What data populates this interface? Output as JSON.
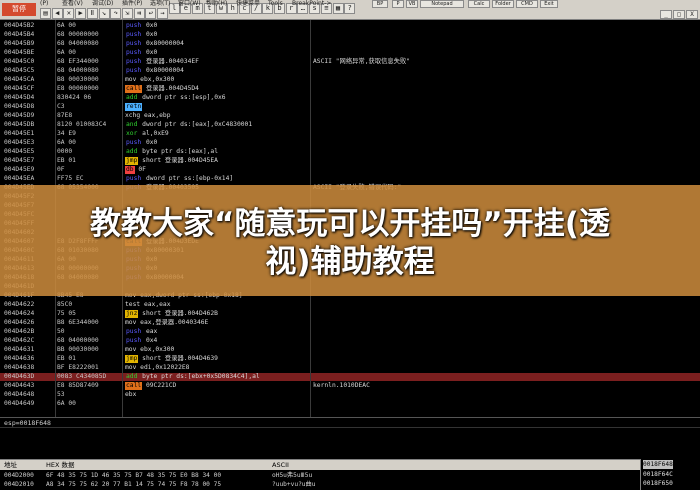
{
  "toolbar": {
    "status": "暂停",
    "icons": [
      "folder-open-icon",
      "rewind-icon",
      "close-icon",
      "play-icon",
      "pause-icon",
      "step-into-icon",
      "step-over-icon",
      "trace-into-icon",
      "trace-over-icon",
      "execute-till-return-icon",
      "goto-icon",
      "letter-l-icon",
      "letter-e-icon",
      "letter-m-icon",
      "letter-t-icon",
      "letter-w-icon",
      "letter-h-icon",
      "letter-c-icon",
      "slash-icon",
      "letter-k-icon",
      "letter-b-icon",
      "letter-r-icon",
      "ellipsis-icon",
      "letter-s-icon",
      "list-icon",
      "grid-icon",
      "help-icon"
    ],
    "menu_fragments": [
      "(P)",
      "查看(V)",
      "调试(D)",
      "插件(P)",
      "选项(T)",
      "窗口(W)",
      "帮助(H)",
      "快捷菜单",
      "Tools",
      "BreakPoint->"
    ],
    "tabs": [
      "BP",
      "P",
      "VB",
      "Notepad",
      "Calc",
      "Folder",
      "CMD",
      "Exit"
    ],
    "window_buttons": [
      "_",
      "□",
      "X"
    ]
  },
  "watermark": {
    "line1": "教教大家“随意玩可以开挂吗”开挂(透",
    "line2": "视)辅助教程"
  },
  "disasm_rows": [
    {
      "addr": "004D45B2",
      "hex": "6A 00",
      "asm": "push 0x0",
      "cmt": ""
    },
    {
      "addr": "004D45B4",
      "hex": "68 00000000",
      "asm": "push 0x0",
      "cmt": ""
    },
    {
      "addr": "004D45B9",
      "hex": "68 04000080",
      "asm": "push 0x80000004",
      "cmt": ""
    },
    {
      "addr": "004D45BE",
      "hex": "6A 00",
      "asm": "push 0x0",
      "cmt": ""
    },
    {
      "addr": "004D45C0",
      "hex": "68 EF344000",
      "asm": "push 登录器.004034EF",
      "cmt": "ASCII \"网络异常,获取信息失败\""
    },
    {
      "addr": "004D45C5",
      "hex": "68 04000080",
      "asm": "push 0x80000004",
      "cmt": ""
    },
    {
      "addr": "004D45CA",
      "hex": "B8 00030000",
      "asm": "mov ebx,0x300",
      "cmt": ""
    },
    {
      "addr": "004D45CF",
      "hex": "E8 00000000",
      "asm": "call 登录器.004D45D4",
      "cmt": ""
    },
    {
      "addr": "004D45D4",
      "hex": "830424 06",
      "asm": "add dword ptr ss:[esp],0x6",
      "cmt": ""
    },
    {
      "addr": "004D45D8",
      "hex": "C3",
      "asm": "retn",
      "cmt": ""
    },
    {
      "addr": "004D45D9",
      "hex": "87E8",
      "asm": "xchg eax,ebp",
      "cmt": ""
    },
    {
      "addr": "004D45DB",
      "hex": "8120 010083C4",
      "asm": "and dword ptr ds:[eax],0xC4830001",
      "cmt": ""
    },
    {
      "addr": "004D45E1",
      "hex": "34 E9",
      "asm": "xor al,0xE9",
      "cmt": ""
    },
    {
      "addr": "004D45E3",
      "hex": "6A 00",
      "asm": "push 0x0",
      "cmt": ""
    },
    {
      "addr": "004D45E5",
      "hex": "0000",
      "asm": "add byte ptr ds:[eax],al",
      "cmt": ""
    },
    {
      "addr": "004D45E7",
      "hex": "EB 01",
      "asm": "jmp short 登录器.004D45EA",
      "cmt": ""
    },
    {
      "addr": "004D45E9",
      "hex": "0F",
      "asm": "db 0F",
      "cmt": ""
    },
    {
      "addr": "004D45EA",
      "hex": "FF75 EC",
      "asm": "push dword ptr ss:[ebp-0x14]",
      "cmt": ""
    },
    {
      "addr": "004D45ED",
      "hex": "68 05354000",
      "asm": "push 登录器.00403505",
      "cmt": "ASCII \"登录失败,错误代码:\""
    },
    {
      "addr": "004D45F2",
      "hex": "",
      "asm": "",
      "cmt": ""
    },
    {
      "addr": "004D45F7",
      "hex": "",
      "asm": "",
      "cmt": ""
    },
    {
      "addr": "004D45FC",
      "hex": "",
      "asm": "[ebp",
      "cmt": ""
    },
    {
      "addr": "004D45FF",
      "hex": "",
      "asm": "",
      "cmt": ""
    },
    {
      "addr": "004D4602",
      "hex": "",
      "asm": "",
      "cmt": ""
    },
    {
      "addr": "004D4607",
      "hex": "E8 D2F8FFFF",
      "asm": "call 登录器.004D3EDE",
      "cmt": ""
    },
    {
      "addr": "004D460C",
      "hex": "68 01030080",
      "asm": "push 0x80000301",
      "cmt": ""
    },
    {
      "addr": "004D4611",
      "hex": "6A 00",
      "asm": "push 0x0",
      "cmt": ""
    },
    {
      "addr": "004D4613",
      "hex": "68 00000000",
      "asm": "push 0x0",
      "cmt": ""
    },
    {
      "addr": "004D4618",
      "hex": "68 04000080",
      "asm": "push 0x80000004",
      "cmt": ""
    },
    {
      "addr": "004D461D",
      "hex": "",
      "asm": "",
      "cmt": ""
    },
    {
      "addr": "004D461F",
      "hex": "8B45 E8",
      "asm": "mov eax,dword ptr ss:[ebp-0x18]",
      "cmt": ""
    },
    {
      "addr": "004D4622",
      "hex": "85C0",
      "asm": "test eax,eax",
      "cmt": ""
    },
    {
      "addr": "004D4624",
      "hex": "75 05",
      "asm": "jnz short 登录器.004D462B",
      "cmt": ""
    },
    {
      "addr": "004D4626",
      "hex": "B8 6E344000",
      "asm": "mov eax,登录器.0040346E",
      "cmt": ""
    },
    {
      "addr": "004D462B",
      "hex": "50",
      "asm": "push eax",
      "cmt": ""
    },
    {
      "addr": "004D462C",
      "hex": "68 04000000",
      "asm": "push 0x4",
      "cmt": ""
    },
    {
      "addr": "004D4631",
      "hex": "BB 00030000",
      "asm": "mov ebx,0x300",
      "cmt": ""
    },
    {
      "addr": "004D4636",
      "hex": "EB 01",
      "asm": "jmp short 登录器.004D4639",
      "cmt": ""
    },
    {
      "addr": "004D4638",
      "hex": "BF E8222001",
      "asm": "mov edi,0x12022E8",
      "cmt": ""
    },
    {
      "addr": "004D463D",
      "hex": "0083 C434085D",
      "asm": "add byte ptr ds:[ebx+0x5D0834C4],al",
      "cmt": ""
    },
    {
      "addr": "004D4643",
      "hex": "E8 85D87409",
      "asm": "call 09C221CD",
      "cmt": "kernln.1010DEAC"
    },
    {
      "addr": "004D4648",
      "hex": "53",
      "asm": "ebx",
      "cmt": ""
    },
    {
      "addr": "004D4649",
      "hex": "6A 00",
      "asm": "",
      "cmt": ""
    }
  ],
  "selected_row_index": 39,
  "info_line": "esp=0018F648",
  "dump": {
    "headers": {
      "addr": "地址",
      "hex": "HEX 数据",
      "ascii": "ASCII"
    },
    "rows": [
      {
        "addr": "004D2000",
        "hex": "6F 48 35 75 1D 46 35 75 B7 48 35 75 E0 B8 34 00",
        "ascii": "oH5u弗5uⅢ5u"
      },
      {
        "addr": "004D2010",
        "hex": "A8 34 75 75 62 20 77 B1 14 75 74 75 F8 78 00 75",
        "ascii": "?uub+vu?u曲u"
      }
    ]
  },
  "stack": {
    "rows": [
      {
        "addr": "0018F648",
        "val": "",
        "selected": true
      },
      {
        "addr": "0018F64C",
        "val": "",
        "selected": false
      },
      {
        "addr": "0018F650",
        "val": "",
        "selected": false
      }
    ]
  },
  "colors": {
    "push": "#5b5bff",
    "call": "#e0701a",
    "jmp": "#e2b400",
    "arith": "#2fd12f",
    "retn": "#4cb0ff",
    "db": "#f04040",
    "selected_row": "#7b1f1f",
    "banner": "#cd8c3c"
  }
}
